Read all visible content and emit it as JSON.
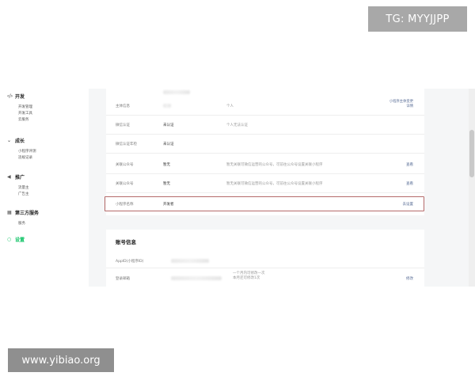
{
  "watermarks": {
    "top": "TG: MYYJJPP",
    "bottom": "www.yibiao.org"
  },
  "sidebar": {
    "groups": [
      {
        "icon": "code-icon",
        "glyph": "‹/›",
        "label": "开发",
        "items": [
          "开发管理",
          "开发工具",
          "云服务"
        ]
      },
      {
        "icon": "growth-icon",
        "glyph": "⌄",
        "label": "成长",
        "items": [
          "小程序评测",
          "违规记录"
        ]
      },
      {
        "icon": "promote-icon",
        "glyph": "◀",
        "label": "推广",
        "items": [
          "流量主",
          "广告主"
        ]
      },
      {
        "icon": "grid-icon",
        "glyph": "▦",
        "label": "第三方服务",
        "items": [
          "服务"
        ]
      },
      {
        "icon": "settings-icon",
        "glyph": "○",
        "label": "设置",
        "items": [],
        "active": true
      }
    ]
  },
  "basic_info": {
    "rows": [
      {
        "label": "主体信息",
        "value": "",
        "desc": "个人",
        "action": ""
      },
      {
        "label": "微信认证",
        "value": "未认证",
        "desc": "个人无法认证",
        "action": ""
      },
      {
        "label": "微信认证年检",
        "value": "未认证",
        "desc": "",
        "action": ""
      },
      {
        "label": "关联公众号",
        "value": "暂无",
        "desc": "暂无关联可微信运营的公众号，可前往公众号设置关联小程序",
        "action": "查看"
      },
      {
        "label": "关联公众号",
        "value": "暂无",
        "desc": "暂无关联可微信运营的公众号，可前往公众号设置关联小程序",
        "action": "查看"
      },
      {
        "label": "小程序名称",
        "value": "开发者",
        "desc": "",
        "action": "去设置"
      }
    ],
    "top_right_note_1": "小程序主体变更",
    "top_right_note_2": "详情"
  },
  "account_info": {
    "title": "账号信息",
    "rows": [
      {
        "label": "AppID(小程序ID)",
        "value": "",
        "desc": "",
        "action": ""
      },
      {
        "label": "登录邮箱",
        "value": "",
        "desc": "一个月内可修改一次",
        "desc2": "本月还可修改1次",
        "action": "修改"
      }
    ]
  }
}
